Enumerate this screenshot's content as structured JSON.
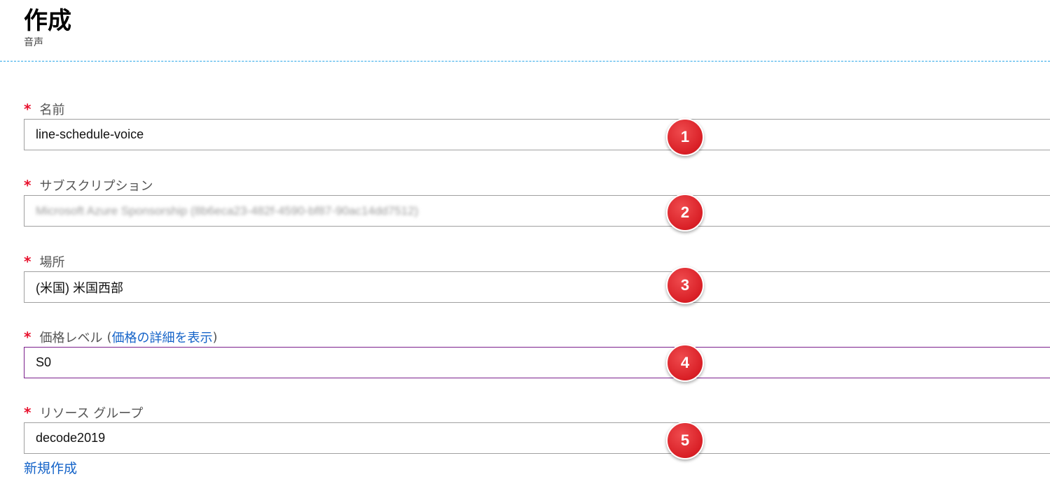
{
  "header": {
    "title": "作成",
    "subtitle": "音声"
  },
  "required_marker": "*",
  "fields": [
    {
      "label": "名前",
      "value": "line-schedule-voice",
      "badge": "1"
    },
    {
      "label": "サブスクリプション",
      "value": "Microsoft Azure Sponsorship (8b6eca23-482f-4590-bf87-90ac14dd7512)",
      "badge": "2"
    },
    {
      "label": "場所",
      "value": "(米国) 米国西部",
      "badge": "3"
    },
    {
      "label": "価格レベル",
      "label_paren_open": "(",
      "label_link": "価格の詳細を表示",
      "label_paren_close": ")",
      "value": "S0",
      "badge": "4"
    },
    {
      "label": "リソース グループ",
      "value": "decode2019",
      "badge": "5"
    }
  ],
  "create_new_link": "新規作成",
  "colors": {
    "required": "#e8112d",
    "link": "#1463c8",
    "divider": "#2aa7e8",
    "badge": "#d91f26",
    "focus_border": "#7b1f8c"
  }
}
